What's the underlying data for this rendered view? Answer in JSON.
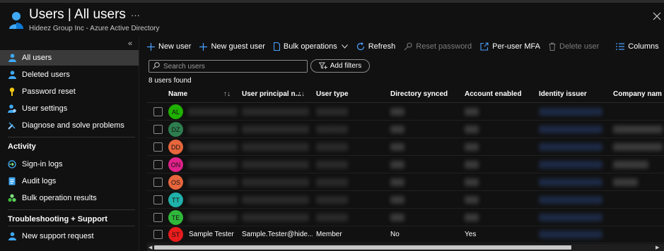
{
  "header": {
    "title": "Users | All users",
    "subtitle": "Hideez Group Inc - Azure Active Directory",
    "more_label": "···"
  },
  "sidebar": {
    "collapse_label": "«",
    "items": [
      {
        "label": "All users",
        "icon": "user-icon",
        "active": true
      },
      {
        "label": "Deleted users",
        "icon": "user-icon"
      },
      {
        "label": "Password reset",
        "icon": "key-icon"
      },
      {
        "label": "User settings",
        "icon": "user-settings-icon"
      },
      {
        "label": "Diagnose and solve problems",
        "icon": "wrench-icon"
      }
    ],
    "activity_heading": "Activity",
    "activity_items": [
      {
        "label": "Sign-in logs",
        "icon": "sign-in-icon"
      },
      {
        "label": "Audit logs",
        "icon": "audit-log-icon"
      },
      {
        "label": "Bulk operation results",
        "icon": "bulk-results-icon"
      }
    ],
    "support_heading": "Troubleshooting + Support",
    "support_items": [
      {
        "label": "New support request",
        "icon": "support-user-icon"
      }
    ]
  },
  "toolbar": {
    "new_user": "New user",
    "new_guest_user": "New guest user",
    "bulk_operations": "Bulk operations",
    "refresh": "Refresh",
    "reset_password": "Reset password",
    "per_user_mfa": "Per-user MFA",
    "delete_user": "Delete user",
    "columns": "Columns",
    "more": "···"
  },
  "search": {
    "placeholder": "Search users",
    "value": ""
  },
  "filters": {
    "add_label": "Add filters"
  },
  "results": {
    "count_text": "8 users found"
  },
  "table": {
    "columns": [
      "Name",
      "User principal n...",
      "User type",
      "Directory synced",
      "Account enabled",
      "Identity issuer",
      "Company nam"
    ],
    "rows": [
      {
        "initials": "AL",
        "color": "#1fb000",
        "name": "",
        "upn": "",
        "type": "",
        "synced": "",
        "enabled": ""
      },
      {
        "initials": "DZ",
        "color": "#2e7d4f",
        "name": "",
        "upn": "",
        "type": "",
        "synced": "",
        "enabled": ""
      },
      {
        "initials": "DD",
        "color": "#e8663c",
        "name": "",
        "upn": "",
        "type": "",
        "synced": "",
        "enabled": ""
      },
      {
        "initials": "ON",
        "color": "#e0218a",
        "name": "",
        "upn": "",
        "type": "",
        "synced": "",
        "enabled": ""
      },
      {
        "initials": "OS",
        "color": "#e8663c",
        "name": "",
        "upn": "",
        "type": "",
        "synced": "",
        "enabled": ""
      },
      {
        "initials": "TT",
        "color": "#20b2aa",
        "name": "",
        "upn": "",
        "type": "",
        "synced": "",
        "enabled": ""
      },
      {
        "initials": "TE",
        "color": "#2fb83a",
        "name": "",
        "upn": "",
        "type": "",
        "synced": "",
        "enabled": ""
      },
      {
        "initials": "ST",
        "color": "#e81c1c",
        "name": "Sample Tester",
        "upn": "Sample.Tester@hide...",
        "type": "Member",
        "synced": "No",
        "enabled": "Yes"
      }
    ]
  },
  "colors": {
    "accent": "#4aa0ff",
    "background": "#111111",
    "active_nav": "#3a3a3a"
  }
}
